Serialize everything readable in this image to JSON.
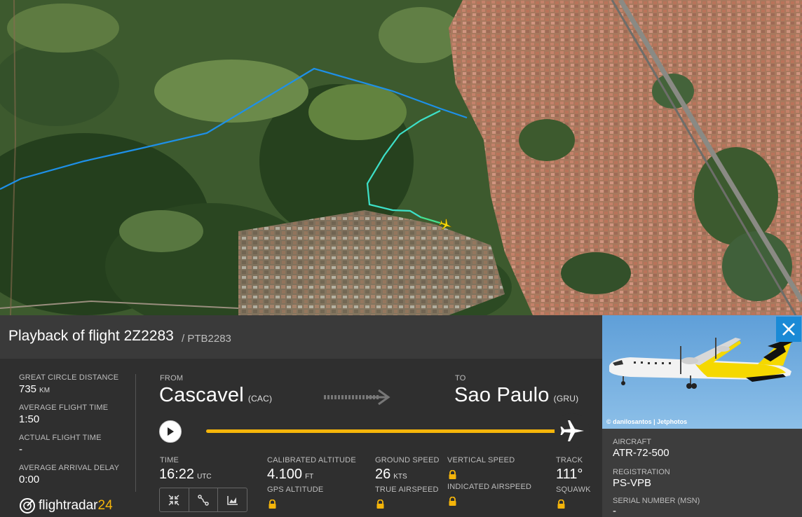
{
  "title": {
    "main": "Playback of flight 2Z2283",
    "sub": "/ PTB2283"
  },
  "stats": {
    "great_circle_label": "GREAT CIRCLE DISTANCE",
    "great_circle_value": "735",
    "great_circle_unit": "KM",
    "avg_time_label": "AVERAGE FLIGHT TIME",
    "avg_time_value": "1:50",
    "actual_time_label": "ACTUAL FLIGHT TIME",
    "actual_time_value": "-",
    "arrival_delay_label": "AVERAGE ARRIVAL DELAY",
    "arrival_delay_value": "0:00"
  },
  "route": {
    "from_label": "FROM",
    "from_city": "Cascavel",
    "from_code": "(CAC)",
    "to_label": "TO",
    "to_city": "Sao Paulo",
    "to_code": "(GRU)"
  },
  "playback": {
    "progress": 1.0,
    "track_color": "#f5b50a"
  },
  "data": {
    "time_label": "TIME",
    "time_value": "16:22",
    "time_unit": "UTC",
    "cal_alt_label": "CALIBRATED ALTITUDE",
    "cal_alt_value": "4.100",
    "cal_alt_unit": "FT",
    "gps_alt_label": "GPS ALTITUDE",
    "ground_speed_label": "GROUND SPEED",
    "ground_speed_value": "26",
    "ground_speed_unit": "KTS",
    "true_airspeed_label": "TRUE AIRSPEED",
    "vertical_speed_label": "VERTICAL SPEED",
    "indicated_airspeed_label": "INDICATED AIRSPEED",
    "track_label": "TRACK",
    "track_value": "111°",
    "squawk_label": "SQUAWK"
  },
  "tools": [
    "collapse-icon",
    "route-icon",
    "chart-icon"
  ],
  "logo": {
    "brand": "flightradar",
    "brand_num": "24"
  },
  "aircraft": {
    "photo_credit": "© danilosantos | Jetphotos",
    "aircraft_label": "AIRCRAFT",
    "aircraft_value": "ATR-72-500",
    "registration_label": "REGISTRATION",
    "registration_value": "PS-VPB",
    "serial_label": "SERIAL NUMBER (MSN)",
    "serial_value": "-"
  },
  "colors": {
    "accent": "#f5b50a",
    "route_blue": "#1e90e8",
    "route_cyan": "#3de0c8",
    "route_green": "#46e08a",
    "close_blue": "#1a8ad6"
  }
}
